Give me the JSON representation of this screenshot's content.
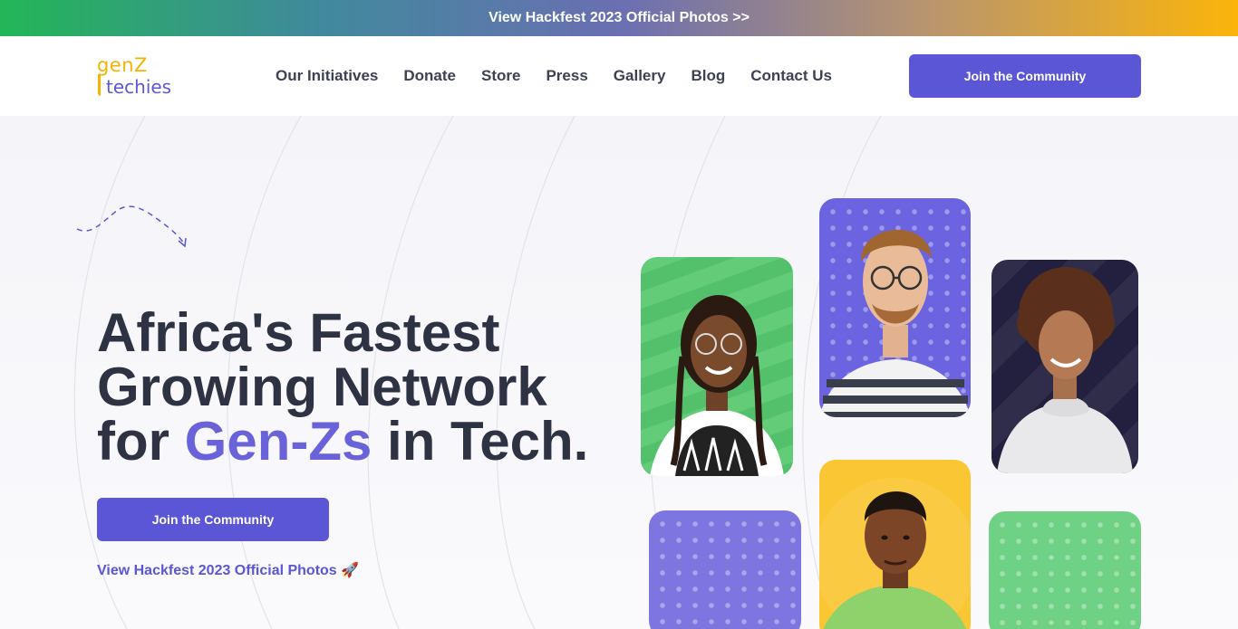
{
  "announcement": {
    "text": "View Hackfest 2023 Official Photos >>"
  },
  "logo": {
    "line1": "genZ",
    "line2": "techies"
  },
  "nav": {
    "items": [
      {
        "label": "Our Initiatives"
      },
      {
        "label": "Donate"
      },
      {
        "label": "Store"
      },
      {
        "label": "Press"
      },
      {
        "label": "Gallery"
      },
      {
        "label": "Blog"
      },
      {
        "label": "Contact Us"
      }
    ],
    "cta_label": "Join the Community"
  },
  "hero": {
    "headline_line1": "Africa's Fastest",
    "headline_line2": "Growing Network",
    "headline_line3_pre": "for ",
    "headline_accent": "Gen-Zs",
    "headline_line3_post": " in Tech.",
    "cta_label": "Join the Community",
    "photos_link": "View Hackfest 2023 Official Photos 🚀"
  },
  "gallery": {
    "cards": [
      {
        "name": "portrait-woman-braids",
        "bg": "#56c86f",
        "pattern": "waves"
      },
      {
        "name": "portrait-man-glasses",
        "bg": "#6b63df",
        "pattern": "dots"
      },
      {
        "name": "portrait-woman-curly",
        "bg": "#23203f",
        "pattern": "stripes"
      },
      {
        "name": "portrait-young-man",
        "bg": "#fbc633",
        "pattern": "none"
      },
      {
        "name": "empty-purple-card",
        "bg": "#7d76e0",
        "pattern": "dots"
      },
      {
        "name": "empty-green-card",
        "bg": "#6fd183",
        "pattern": "dots"
      }
    ]
  },
  "colors": {
    "accent": "#5a56d6",
    "heading": "#2d3343",
    "gradient_start": "#23b657",
    "gradient_end": "#fbb50a"
  }
}
